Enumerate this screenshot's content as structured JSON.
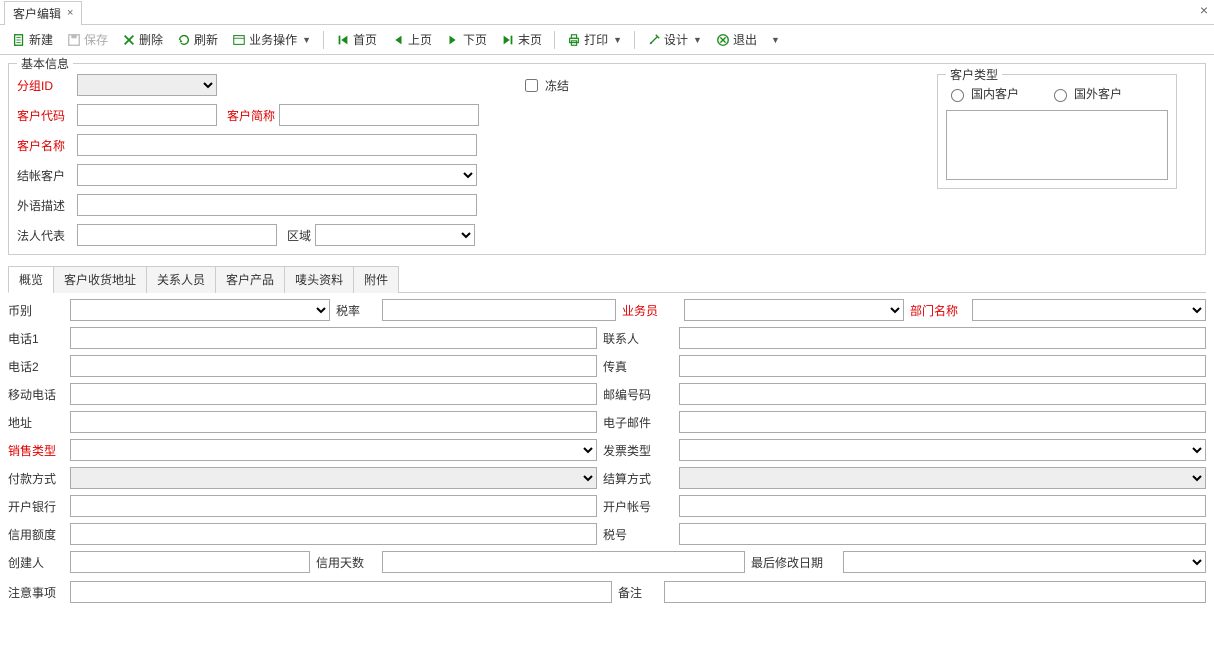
{
  "tab": {
    "title": "客户编辑"
  },
  "toolbar": {
    "new": "新建",
    "save": "保存",
    "delete": "删除",
    "refresh": "刷新",
    "bizop": "业务操作",
    "first": "首页",
    "prev": "上页",
    "next": "下页",
    "last": "末页",
    "print": "打印",
    "design": "设计",
    "exit": "退出"
  },
  "basic": {
    "legend": "基本信息",
    "groupId": "分组ID",
    "freeze": "冻结",
    "custCode": "客户代码",
    "custShort": "客户简称",
    "custName": "客户名称",
    "acctCust": "结帐客户",
    "foreignDesc": "外语描述",
    "legalRep": "法人代表",
    "region": "区域"
  },
  "custType": {
    "legend": "客户类型",
    "domestic": "国内客户",
    "foreign": "国外客户"
  },
  "subTabs": [
    "概览",
    "客户收货地址",
    "关系人员",
    "客户产品",
    "唛头资料",
    "附件"
  ],
  "ov": {
    "currency": "币别",
    "taxRate": "税率",
    "salesman": "业务员",
    "deptName": "部门名称",
    "phone1": "电话1",
    "contact": "联系人",
    "phone2": "电话2",
    "fax": "传真",
    "mobile": "移动电话",
    "postcode": "邮编号码",
    "address": "地址",
    "email": "电子邮件",
    "salesType": "销售类型",
    "invoiceType": "发票类型",
    "payMethod": "付款方式",
    "settleMethod": "结算方式",
    "bank": "开户银行",
    "acctNo": "开户帐号",
    "creditLimit": "信用额度",
    "taxNo": "税号",
    "creator": "创建人",
    "creditDays": "信用天数",
    "lastModify": "最后修改日期",
    "notes": "注意事项",
    "remark": "备注"
  }
}
